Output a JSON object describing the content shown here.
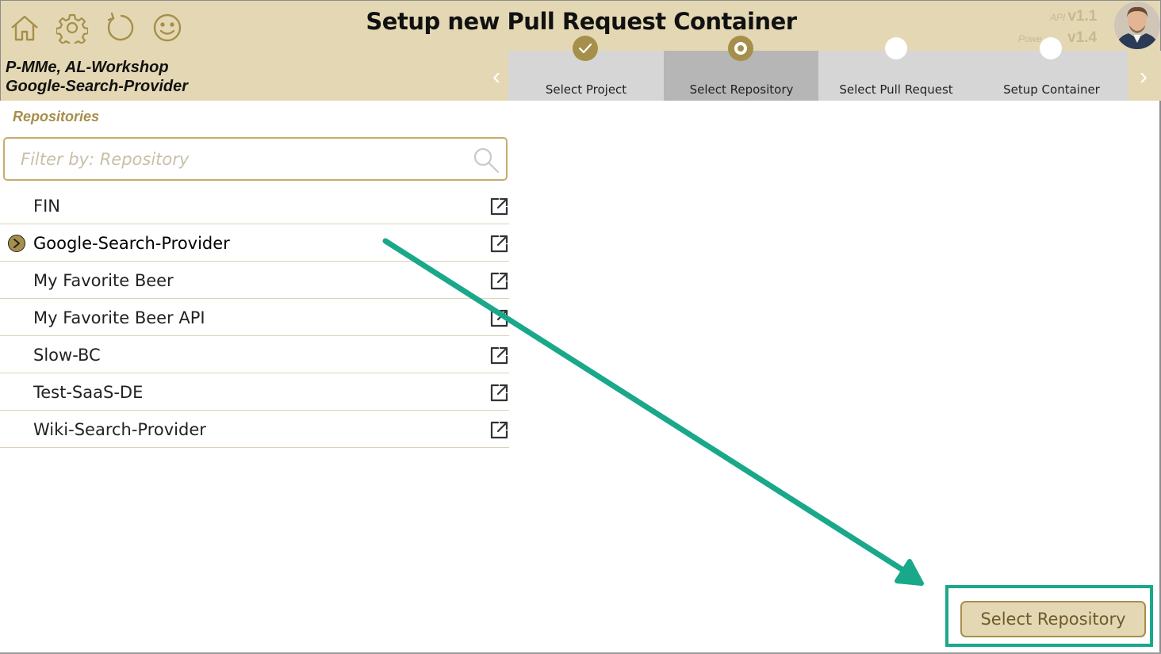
{
  "header": {
    "title": "Setup new Pull Request Container",
    "icons": [
      "home-icon",
      "gear-icon",
      "refresh-icon",
      "smiley-icon"
    ],
    "api_label": "API",
    "api_version": "v1.1",
    "app_label": "Powe",
    "app_version": "v1.4"
  },
  "project": {
    "line1": "P-MMe, AL-Workshop",
    "line2": "Google-Search-Provider"
  },
  "steps": [
    {
      "label": "Select Project",
      "state": "done"
    },
    {
      "label": "Select Repository",
      "state": "current"
    },
    {
      "label": "Select Pull Request",
      "state": "todo"
    },
    {
      "label": "Setup Container",
      "state": "todo"
    }
  ],
  "panel": {
    "label": "Repositories",
    "search_placeholder": "Filter by: Repository"
  },
  "repositories": [
    {
      "name": "FIN",
      "selected": false
    },
    {
      "name": "Google-Search-Provider",
      "selected": true
    },
    {
      "name": "My Favorite Beer",
      "selected": false
    },
    {
      "name": "My Favorite Beer API",
      "selected": false
    },
    {
      "name": "Slow-BC",
      "selected": false
    },
    {
      "name": "Test-SaaS-DE",
      "selected": false
    },
    {
      "name": "Wiki-Search-Provider",
      "selected": false
    }
  ],
  "actions": {
    "select_button": "Select Repository"
  },
  "colors": {
    "accent": "#a68f4a",
    "header_bg": "#e4d8b4",
    "annotation": "#1aa88a"
  }
}
